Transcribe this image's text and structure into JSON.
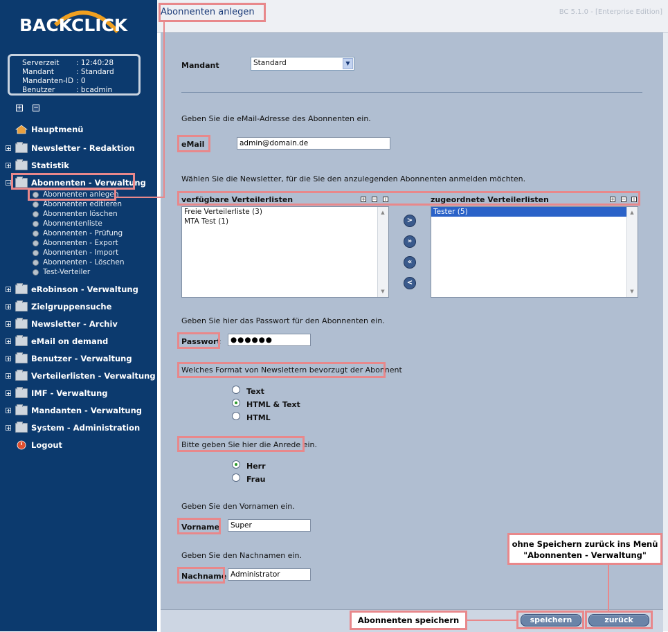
{
  "app": {
    "logo": "BACKCLICK",
    "version": "BC 5.1.0 - [Enterprise Edition]",
    "page_title": "Abonnenten anlegen"
  },
  "info": {
    "serverzeit_label": "Serverzeit",
    "serverzeit": ": 12:40:28",
    "mandant_label": "Mandant",
    "mandant": ": Standard",
    "mandanten_id_label": "Mandanten-ID",
    "mandanten_id": ": 0",
    "benutzer_label": "Benutzer",
    "benutzer": ": bcadmin"
  },
  "nav": {
    "home": "Hauptmenü",
    "items": [
      "Newsletter - Redaktion",
      "Statistik",
      "Abonnenten - Verwaltung",
      "eRobinson - Verwaltung",
      "Zielgruppensuche",
      "Newsletter - Archiv",
      "eMail on demand",
      "Benutzer - Verwaltung",
      "Verteilerlisten - Verwaltung",
      "IMF - Verwaltung",
      "Mandanten - Verwaltung",
      "System - Administration"
    ],
    "logout": "Logout",
    "sub": [
      "Abonnenten anlegen",
      "Abonnenten editieren",
      "Abonnenten löschen",
      "Abonnentenliste",
      "Abonnenten - Prüfung",
      "Abonnenten - Export",
      "Abonnenten - Import",
      "Abonnenten - Löschen",
      "Test-Verteiler"
    ]
  },
  "form": {
    "mandant_label": "Mandant",
    "mandant_value": "Standard",
    "email_hint": "Geben Sie die eMail-Adresse des Abonnenten ein.",
    "email_label": "eMail",
    "email_value": "admin@domain.de",
    "newsletter_hint": "Wählen Sie die Newsletter, für die Sie den anzulegenden Abonnenten anmelden möchten.",
    "available_header": "verfügbare Verteilerlisten",
    "assigned_header": "zugeordnete Verteilerlisten",
    "available": [
      "Freie Verteilerliste (3)",
      "MTA Test (1)"
    ],
    "assigned": [
      "Tester (5)"
    ],
    "password_hint": "Geben Sie hier das Passwort für den Abonnenten ein.",
    "password_label": "Passwort",
    "password_value": "●●●●●●",
    "format_hint": "Welches Format von Newslettern bevorzugt der Abonnent",
    "format_options": [
      "Text",
      "HTML & Text",
      "HTML"
    ],
    "format_selected": "HTML & Text",
    "salutation_hint": "Bitte geben Sie hier die Anrede ein.",
    "salutation_options": [
      "Herr",
      "Frau"
    ],
    "salutation_selected": "Herr",
    "firstname_hint": "Geben Sie den Vornamen ein.",
    "firstname_label": "Vorname",
    "firstname_value": "Super",
    "lastname_hint": "Geben Sie den Nachnamen ein.",
    "lastname_label": "Nachname",
    "lastname_value": "Administrator"
  },
  "buttons": {
    "save": "speichern",
    "back": "zurück"
  },
  "annotations": {
    "save_callout": "Abonnenten speichern",
    "back_callout_line1": "ohne Speichern zurück ins Menü",
    "back_callout_line2": "\"Abonnenten - Verwaltung\""
  },
  "colors": {
    "sidebar": "#0c3a6e",
    "content": "#b0bed1",
    "highlight": "#e8888b"
  }
}
